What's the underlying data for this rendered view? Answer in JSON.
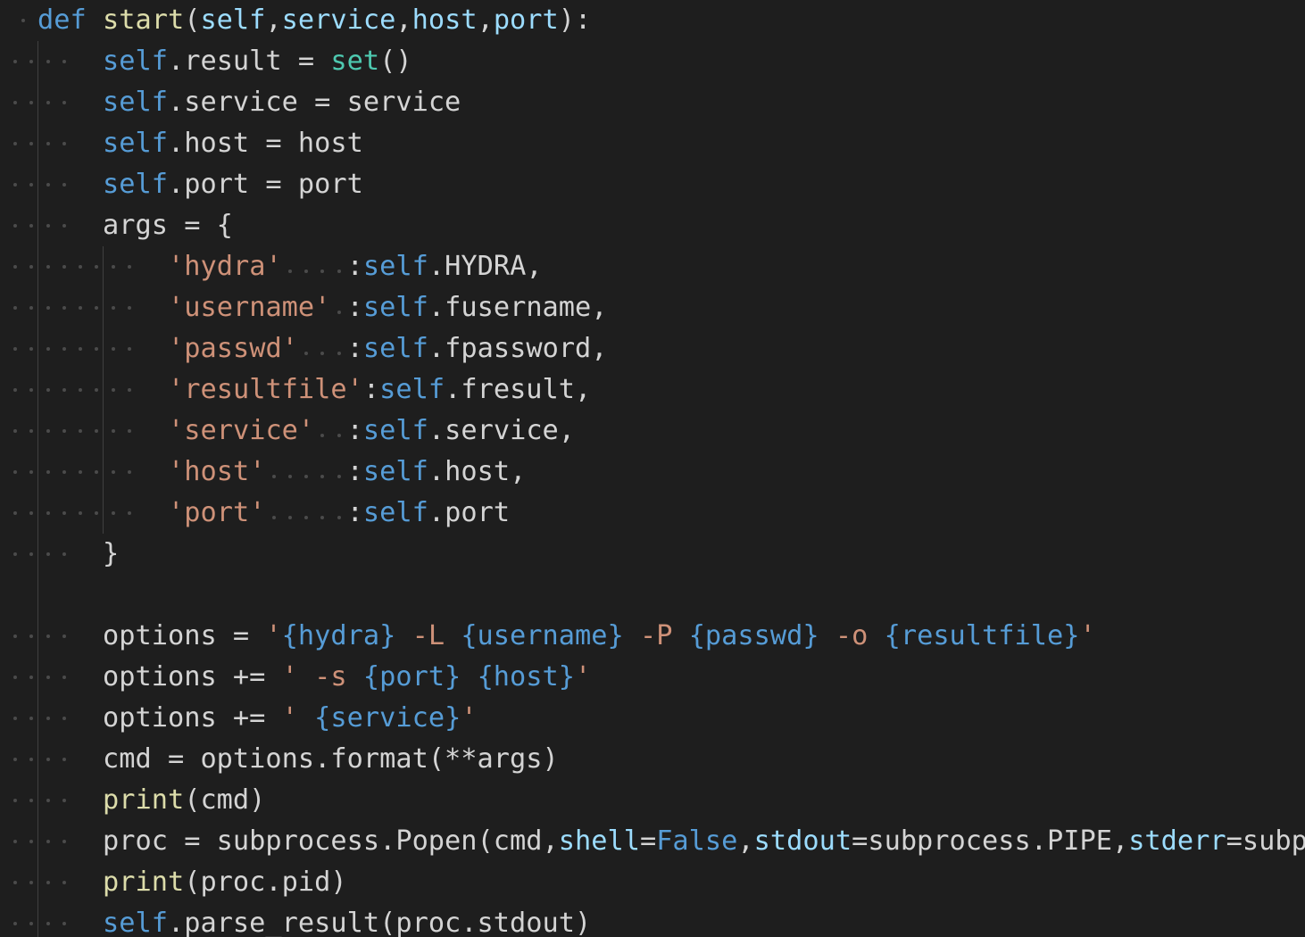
{
  "editor": {
    "language": "python",
    "colors": {
      "background": "#1e1e1e",
      "plain": "#d4d4d4",
      "keyword": "#569cd6",
      "function": "#dcdcaa",
      "builtin": "#4ec9b0",
      "string": "#ce9178",
      "parameter": "#9cdcfe",
      "whitespace_marker": "#4b4b4b"
    },
    "lines": [
      {
        "indent": 0,
        "tokens": [
          [
            "kw",
            "def"
          ],
          [
            "pl",
            " "
          ],
          [
            "fn",
            "start"
          ],
          [
            "pl",
            "("
          ],
          [
            "par",
            "self"
          ],
          [
            "pl",
            ","
          ],
          [
            "par",
            "service"
          ],
          [
            "pl",
            ","
          ],
          [
            "par",
            "host"
          ],
          [
            "pl",
            ","
          ],
          [
            "par",
            "port"
          ],
          [
            "pl",
            "):"
          ]
        ]
      },
      {
        "indent": 1,
        "tokens": [
          [
            "sf",
            "self"
          ],
          [
            "pl",
            ".result = "
          ],
          [
            "bi",
            "set"
          ],
          [
            "pl",
            "()"
          ]
        ]
      },
      {
        "indent": 1,
        "tokens": [
          [
            "sf",
            "self"
          ],
          [
            "pl",
            ".service = service"
          ]
        ]
      },
      {
        "indent": 1,
        "tokens": [
          [
            "sf",
            "self"
          ],
          [
            "pl",
            ".host = host"
          ]
        ]
      },
      {
        "indent": 1,
        "tokens": [
          [
            "sf",
            "self"
          ],
          [
            "pl",
            ".port = port"
          ]
        ]
      },
      {
        "indent": 1,
        "tokens": [
          [
            "pl",
            "args = {"
          ]
        ]
      },
      {
        "indent": 2,
        "tokens": [
          [
            "str",
            "'hydra'"
          ],
          [
            "ws",
            "    "
          ],
          [
            "pl",
            ":"
          ],
          [
            "sf",
            "self"
          ],
          [
            "pl",
            ".HYDRA,"
          ]
        ]
      },
      {
        "indent": 2,
        "tokens": [
          [
            "str",
            "'username'"
          ],
          [
            "ws",
            " "
          ],
          [
            "pl",
            ":"
          ],
          [
            "sf",
            "self"
          ],
          [
            "pl",
            ".fusername,"
          ]
        ]
      },
      {
        "indent": 2,
        "tokens": [
          [
            "str",
            "'passwd'"
          ],
          [
            "ws",
            "   "
          ],
          [
            "pl",
            ":"
          ],
          [
            "sf",
            "self"
          ],
          [
            "pl",
            ".fpassword,"
          ]
        ]
      },
      {
        "indent": 2,
        "tokens": [
          [
            "str",
            "'resultfile'"
          ],
          [
            "pl",
            ":"
          ],
          [
            "sf",
            "self"
          ],
          [
            "pl",
            ".fresult,"
          ]
        ]
      },
      {
        "indent": 2,
        "tokens": [
          [
            "str",
            "'service'"
          ],
          [
            "ws",
            "  "
          ],
          [
            "pl",
            ":"
          ],
          [
            "sf",
            "self"
          ],
          [
            "pl",
            ".service,"
          ]
        ]
      },
      {
        "indent": 2,
        "tokens": [
          [
            "str",
            "'host'"
          ],
          [
            "ws",
            "     "
          ],
          [
            "pl",
            ":"
          ],
          [
            "sf",
            "self"
          ],
          [
            "pl",
            ".host,"
          ]
        ]
      },
      {
        "indent": 2,
        "tokens": [
          [
            "str",
            "'port'"
          ],
          [
            "ws",
            "     "
          ],
          [
            "pl",
            ":"
          ],
          [
            "sf",
            "self"
          ],
          [
            "pl",
            ".port"
          ]
        ]
      },
      {
        "indent": 1,
        "tokens": [
          [
            "pl",
            "}"
          ]
        ]
      },
      {
        "indent": 0,
        "blank": true,
        "tokens": []
      },
      {
        "indent": 1,
        "tokens": [
          [
            "pl",
            "options = "
          ],
          [
            "str",
            "'"
          ],
          [
            "esc",
            "{hydra}"
          ],
          [
            "str",
            " -L "
          ],
          [
            "esc",
            "{username}"
          ],
          [
            "str",
            " -P "
          ],
          [
            "esc",
            "{passwd}"
          ],
          [
            "str",
            " -o "
          ],
          [
            "esc",
            "{resultfile}"
          ],
          [
            "str",
            "'"
          ]
        ]
      },
      {
        "indent": 1,
        "tokens": [
          [
            "pl",
            "options += "
          ],
          [
            "str",
            "' -s "
          ],
          [
            "esc",
            "{port}"
          ],
          [
            "str",
            " "
          ],
          [
            "esc",
            "{host}"
          ],
          [
            "str",
            "'"
          ]
        ]
      },
      {
        "indent": 1,
        "tokens": [
          [
            "pl",
            "options += "
          ],
          [
            "str",
            "' "
          ],
          [
            "esc",
            "{service}"
          ],
          [
            "str",
            "'"
          ]
        ]
      },
      {
        "indent": 1,
        "tokens": [
          [
            "pl",
            "cmd = options.format(**args)"
          ]
        ]
      },
      {
        "indent": 1,
        "tokens": [
          [
            "fn",
            "print"
          ],
          [
            "pl",
            "(cmd)"
          ]
        ]
      },
      {
        "indent": 1,
        "tokens": [
          [
            "pl",
            "proc = subprocess.Popen(cmd,"
          ],
          [
            "par",
            "shell"
          ],
          [
            "pl",
            "="
          ],
          [
            "kw",
            "False"
          ],
          [
            "pl",
            ","
          ],
          [
            "par",
            "stdout"
          ],
          [
            "pl",
            "=subprocess.PIPE,"
          ],
          [
            "par",
            "stderr"
          ],
          [
            "pl",
            "=subprocess.PIPE)"
          ]
        ]
      },
      {
        "indent": 1,
        "tokens": [
          [
            "fn",
            "print"
          ],
          [
            "pl",
            "(proc.pid)"
          ]
        ]
      },
      {
        "indent": 1,
        "tokens": [
          [
            "sf",
            "self"
          ],
          [
            "pl",
            ".parse_result(proc.stdout)"
          ]
        ]
      }
    ]
  }
}
